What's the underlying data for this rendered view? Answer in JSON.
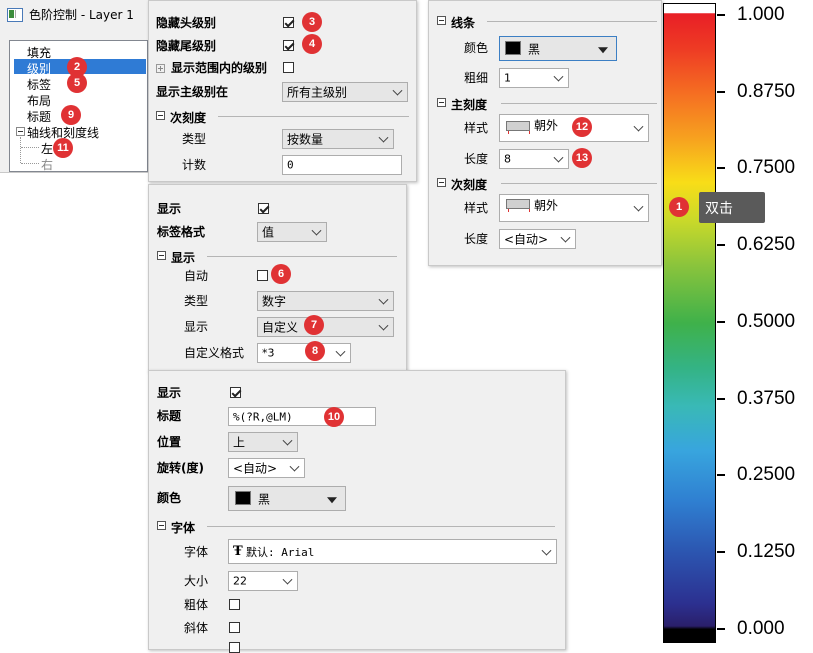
{
  "window": {
    "title": "色阶控制 - Layer 1"
  },
  "tree": {
    "items": [
      {
        "label": "填充"
      },
      {
        "label": "级别"
      },
      {
        "label": "标签"
      },
      {
        "label": "布局"
      },
      {
        "label": "标题"
      },
      {
        "label": "轴线和刻度线"
      },
      {
        "label": "左"
      },
      {
        "label": "右"
      }
    ]
  },
  "levels_panel": {
    "hide_head_label": "隐藏头级别",
    "hide_tail_label": "隐藏尾级别",
    "show_in_range_label": "显示范围内的级别",
    "show_major_at_label": "显示主级别在",
    "show_major_at_value": "所有主级别",
    "minor_section": "次刻度",
    "type_label": "类型",
    "type_value": "按数量",
    "count_label": "计数",
    "count_value": "0"
  },
  "labels_panel": {
    "show_label": "显示",
    "format_label": "标签格式",
    "format_value": "值",
    "display_section": "显示",
    "auto_label": "自动",
    "type_label": "类型",
    "type_value": "数字",
    "display_label": "显示",
    "display_value": "自定义",
    "custom_format_label": "自定义格式",
    "custom_format_value": "*3"
  },
  "title_panel": {
    "show_label": "显示",
    "title_label": "标题",
    "title_value": "%(?R,@LM)",
    "position_label": "位置",
    "position_value": "上",
    "rotation_label": "旋转(度)",
    "rotation_value": "<自动>",
    "color_label": "颜色",
    "color_value": "黑",
    "font_section": "字体",
    "font_label": "字体",
    "font_value": "默认: Arial",
    "size_label": "大小",
    "size_value": "22",
    "bold_label": "粗体",
    "italic_label": "斜体"
  },
  "axis_panel": {
    "line_section": "线条",
    "color_label": "颜色",
    "color_value": "黑",
    "width_label": "粗细",
    "width_value": "1",
    "major_section": "主刻度",
    "major_style_label": "样式",
    "major_style_value": "朝外",
    "major_length_label": "长度",
    "major_length_value": "8",
    "minor_section": "次刻度",
    "minor_style_label": "样式",
    "minor_style_value": "朝外",
    "minor_length_label": "长度",
    "minor_length_value": "<自动>"
  },
  "colorbar": {
    "tick_labels": [
      "1.000",
      "0.8750",
      "0.7500",
      "0.6250",
      "0.5000",
      "0.3750",
      "0.2500",
      "0.1250",
      "0.000"
    ],
    "tooltip": "双击"
  },
  "badges": [
    "1",
    "2",
    "3",
    "4",
    "5",
    "6",
    "7",
    "8",
    "9",
    "10",
    "11",
    "12",
    "13"
  ],
  "colors": {
    "badge": "#e03234",
    "selection": "#2f7bd5",
    "tooltip_bg": "#5a5a5a",
    "panel_bg": "#f0f0f0"
  }
}
